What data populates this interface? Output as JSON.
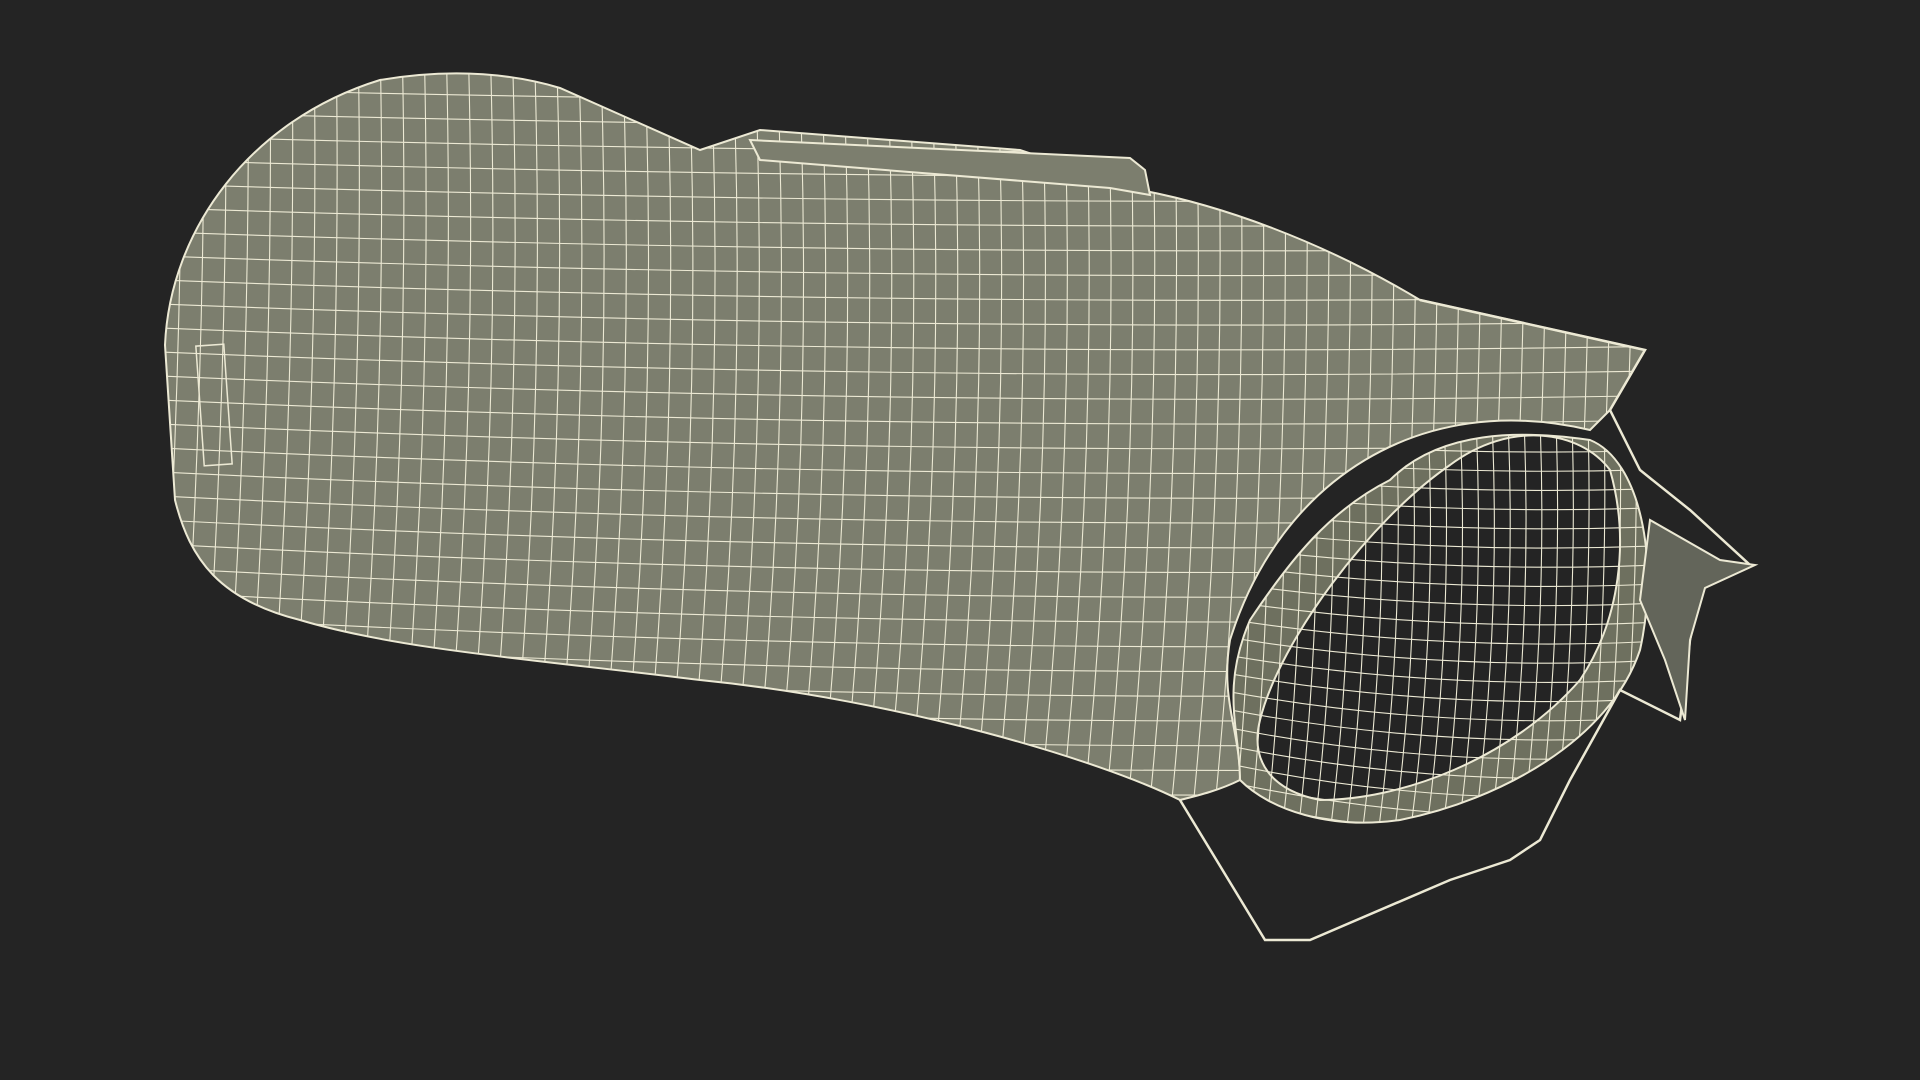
{
  "viewport": {
    "background_color": "#242424",
    "model": {
      "name": "wireframe-bag-model",
      "surface_color": "#7c7e6e",
      "inner_surface_color": "#6e705f",
      "shadow_color": "#63655a",
      "wire_color": "#ece9d4"
    }
  }
}
